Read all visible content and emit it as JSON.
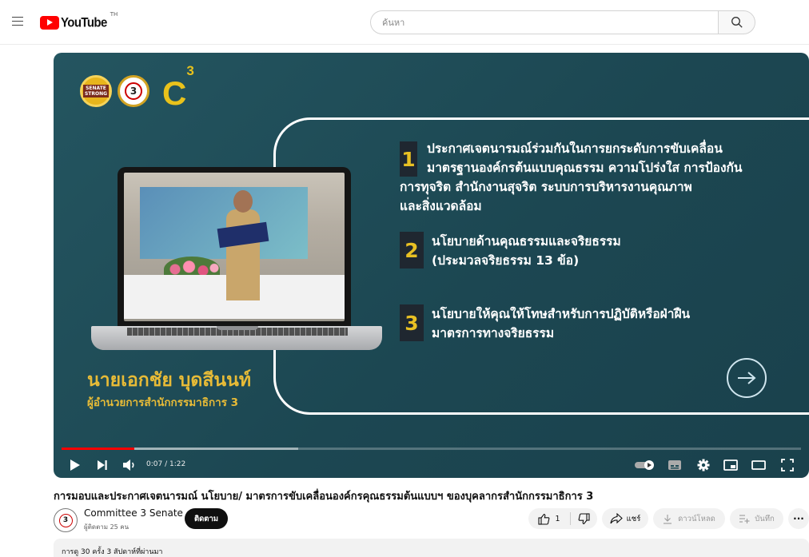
{
  "masthead": {
    "logo_text": "YouTube",
    "region": "TH",
    "search_placeholder": "ค้นหา"
  },
  "slide": {
    "badge_senate_line1": "SENATE",
    "badge_senate_line2": "STRONG",
    "badge_c3_num": "3",
    "c3_letter": "C",
    "c3_sup": "3",
    "point1_num": "1",
    "point1_line1": "ประกาศเจตนารมณ์ร่วมกันในการยกระดับการขับเคลื่อน",
    "point1_line2": "มาตรฐานองค์กรต้นแบบคุณธรรม ความโปร่งใส การป้องกัน",
    "point1_line3": "การทุจริต สำนักงานสุจริต ระบบการบริหารงานคุณภาพ",
    "point1_line4": "และสิ่งแวดล้อม",
    "point2_num": "2",
    "point2_line1": "นโยบายด้านคุณธรรมและจริยธรรม",
    "point2_line2": "(ประมวลจริยธรรม 13 ข้อ)",
    "point3_num": "3",
    "point3_line1": "นโยบายให้คุณให้โทษสำหรับการปฏิบัติหรือฝ่าฝืน",
    "point3_line2": "มาตรการทางจริยธรรม",
    "presenter_name": "นายเอกชัย บุดสีนนท์",
    "presenter_role": "ผู้อำนวยการสำนักกรรมาธิการ 3"
  },
  "player": {
    "time": "0:07 / 1:22",
    "progress_played": 0.098,
    "progress_buffered": 0.32
  },
  "video": {
    "title": "การมอบและประกาศเจตนารมณ์ นโยบาย/ มาตรการขับเคลื่อนองค์กรคุณธรรมต้นแบบฯ ของบุคลากรสำนักกรรมาธิการ 3",
    "channel_name": "Committee 3 Senate",
    "channel_avatar_num": "3",
    "subscriber_count": "ผู้ติดตาม 25 คน",
    "subscribe_label": "ติดตาม",
    "like_count": "1",
    "share_label": "แชร์",
    "download_label": "ดาวน์โหลด",
    "save_label": "บันทึก",
    "more_label": "···",
    "description_meta": "การดู 30 ครั้ง  3 สัปดาห์ที่ผ่านมา"
  }
}
